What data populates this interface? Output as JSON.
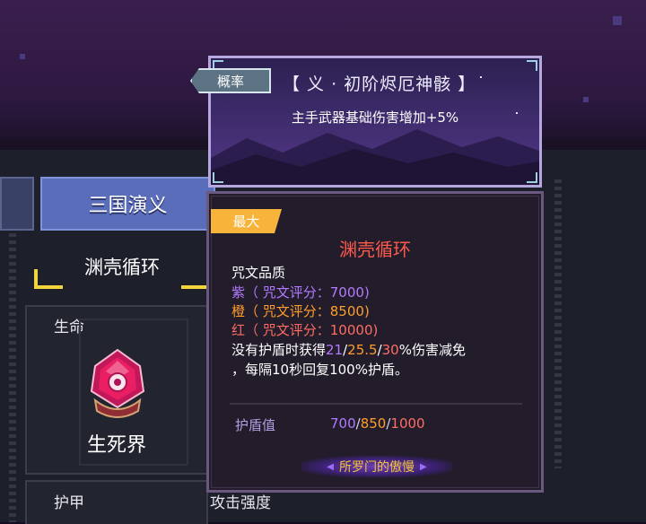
{
  "left_tabs": {
    "active_tab": "三国演义"
  },
  "set": {
    "name": "渊壳循环"
  },
  "stats": {
    "hp_label": "生命",
    "armor_label": "护甲",
    "attack_label": "攻击强度"
  },
  "item": {
    "name": "生死界"
  },
  "banner": {
    "tag": "概率",
    "title": "【 义 · 初阶烬厄神骸 】",
    "description": "主手武器基础伤害增加+5%"
  },
  "card": {
    "badge": "最大",
    "name": "渊壳循环",
    "quality_title": "咒文品质",
    "tiers": [
      {
        "text": "紫（ 咒文评分：7000)",
        "color": "#b37bff"
      },
      {
        "text": "橙（ 咒文评分：8500)",
        "color": "#ff9e2a"
      },
      {
        "text": "红（ 咒文评分：10000)",
        "color": "#ff6d63"
      }
    ],
    "effect": {
      "prefix": "没有护盾时获得",
      "v1": "21",
      "s1": "/",
      "v2": "25.5",
      "s2": "/",
      "v3": "30",
      "suffix": "%伤害减免",
      "line2": "，每隔10秒回复100%护盾。"
    },
    "shield_label": "护盾值",
    "shield_values": {
      "v1": "700",
      "v2": "850",
      "v3": "1000",
      "sep": "/"
    },
    "set_button": "所罗门的傲慢"
  },
  "colors": {
    "purple": "#b37bff",
    "orange": "#ff9e2a",
    "red": "#ff6d63",
    "gold": "#f2c33a",
    "name_red": "#ff5a4c"
  },
  "icons": [
    "gem-crystal-icon",
    "arrow-left-icon",
    "arrow-right-icon"
  ]
}
